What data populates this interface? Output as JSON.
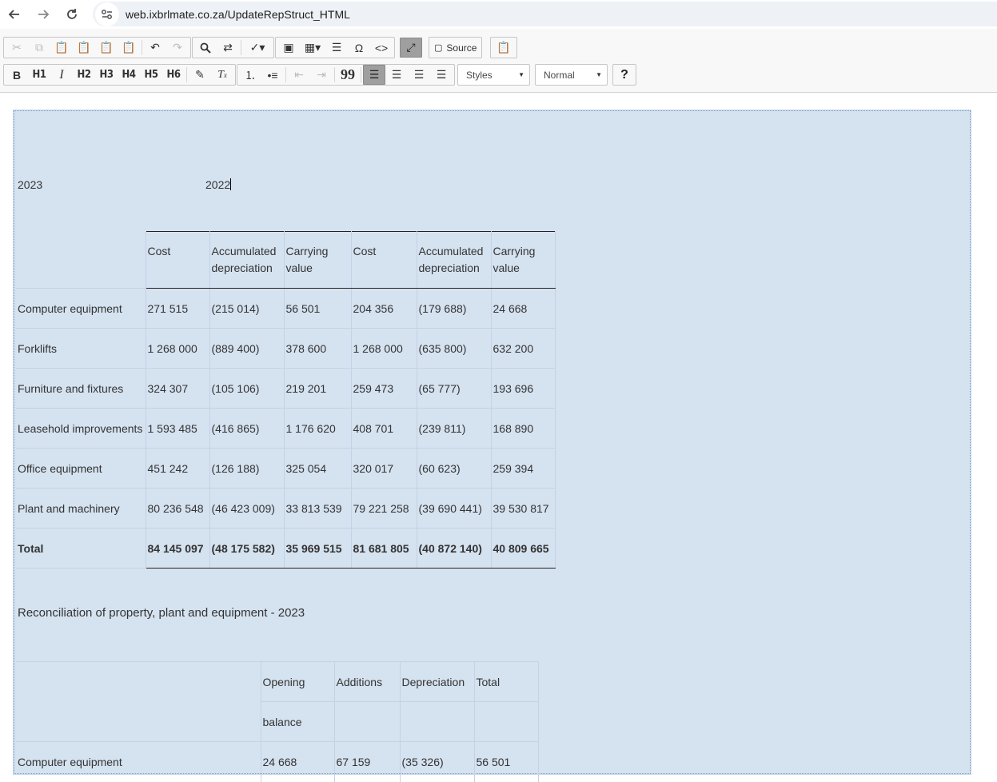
{
  "browser": {
    "url": "web.ixbrlmate.co.za/UpdateRepStruct_HTML"
  },
  "toolbar": {
    "styles_label": "Styles",
    "format_label": "Normal",
    "source_label": "Source",
    "help_label": "?",
    "headings": [
      "H1",
      "H2",
      "H3",
      "H4",
      "H5",
      "H6"
    ],
    "bold_label": "B",
    "italic_label": "I",
    "special_char_label": "Ω",
    "blockquote_label": "99"
  },
  "doc": {
    "year_current": "2023",
    "year_prior": "2022",
    "ppe_table": {
      "headers": [
        [
          "Cost"
        ],
        [
          "Accumulated",
          "depreciation"
        ],
        [
          "Carrying",
          "value"
        ],
        [
          "Cost"
        ],
        [
          "Accumulated",
          "depreciation"
        ],
        [
          "Carrying",
          "value"
        ]
      ],
      "rows": [
        {
          "label": "Computer equipment",
          "values": [
            "271 515",
            "(215 014)",
            "56 501",
            "204 356",
            "(179 688)",
            "24 668"
          ]
        },
        {
          "label": "Forklifts",
          "values": [
            "1 268 000",
            "(889 400)",
            "378 600",
            "1 268 000",
            "(635 800)",
            "632 200"
          ]
        },
        {
          "label": "Furniture and fixtures",
          "values": [
            "324 307",
            "(105 106)",
            "219 201",
            "259 473",
            "(65 777)",
            "193 696"
          ]
        },
        {
          "label": "Leasehold improvements",
          "values": [
            "1 593 485",
            "(416 865)",
            "1 176 620",
            "408 701",
            "(239 811)",
            "168 890"
          ]
        },
        {
          "label": "Office equipment",
          "values": [
            "451 242",
            "(126 188)",
            "325 054",
            "320 017",
            "(60 623)",
            "259 394"
          ]
        },
        {
          "label": "Plant and machinery",
          "values": [
            "80 236 548",
            "(46 423 009)",
            "33 813 539",
            "79 221 258",
            "(39 690 441)",
            "39 530 817"
          ]
        }
      ],
      "total": {
        "label": "Total",
        "values": [
          "84 145 097",
          "(48 175 582)",
          "35 969 515",
          "81 681 805",
          "(40 872 140)",
          "40 809 665"
        ]
      }
    },
    "recon_title": "Reconciliation of property, plant and equipment - 2023",
    "recon_table": {
      "headers": [
        "Opening",
        "Additions",
        "Depreciation",
        "Total"
      ],
      "headers_line2": [
        "balance",
        "",
        "",
        ""
      ],
      "rows": [
        {
          "label": "Computer equipment",
          "values": [
            "24 668",
            "67 159",
            "(35 326)",
            "56 501"
          ]
        }
      ]
    }
  }
}
